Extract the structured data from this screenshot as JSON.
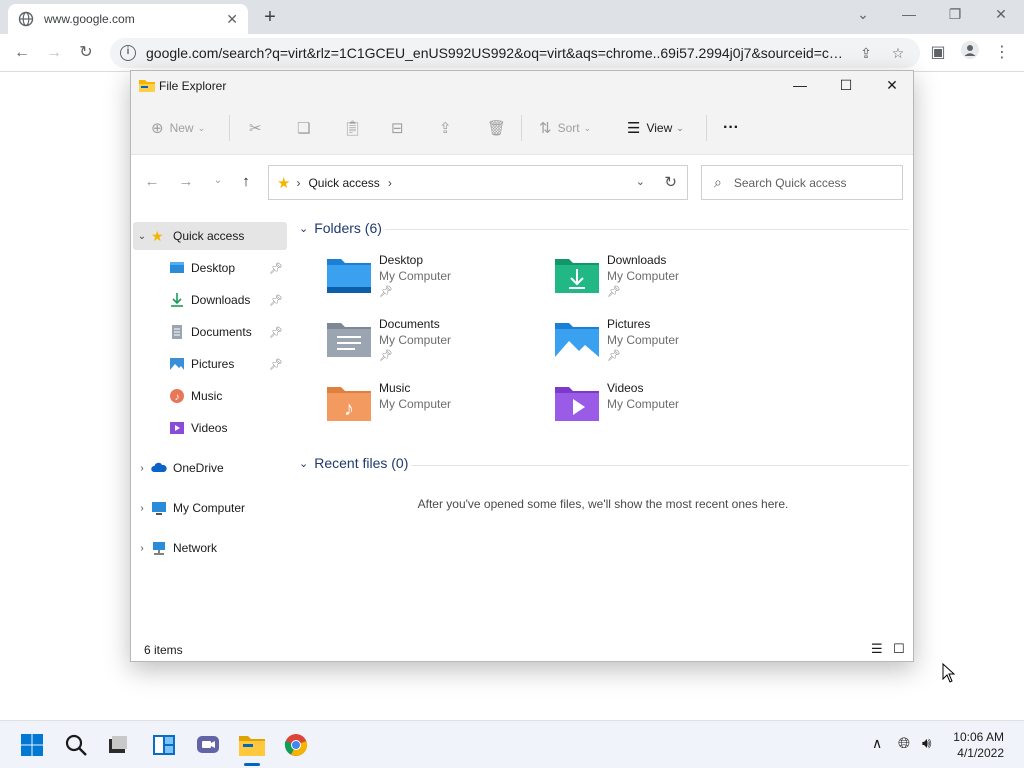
{
  "browser": {
    "tab_title": "www.google.com",
    "tab_close": "✕",
    "new_tab": "+",
    "url": "google.com/search?q=virt&rlz=1C1GCEU_enUS992US992&oq=virt&aqs=chrome..69i57.2994j0j7&sourceid=chr..."
  },
  "explorer": {
    "title": "File Explorer",
    "commands": {
      "new": "New",
      "sort": "Sort",
      "view": "View",
      "more": "···"
    },
    "address": {
      "location": "Quick access"
    },
    "search_placeholder": "Search Quick access",
    "nav": {
      "quick_access": "Quick access",
      "items": [
        "Desktop",
        "Downloads",
        "Documents",
        "Pictures",
        "Music",
        "Videos"
      ],
      "onedrive": "OneDrive",
      "my_computer": "My Computer",
      "network": "Network"
    },
    "folders_header": "Folders (6)",
    "folders": [
      {
        "name": "Desktop",
        "location": "My Computer",
        "pinned": true
      },
      {
        "name": "Downloads",
        "location": "My Computer",
        "pinned": true
      },
      {
        "name": "Documents",
        "location": "My Computer",
        "pinned": true
      },
      {
        "name": "Pictures",
        "location": "My Computer",
        "pinned": true
      },
      {
        "name": "Music",
        "location": "My Computer",
        "pinned": false
      },
      {
        "name": "Videos",
        "location": "My Computer",
        "pinned": false
      }
    ],
    "recent_header": "Recent files (0)",
    "recent_empty": "After you've opened some files, we'll show the most recent ones here.",
    "status_count": "6 items"
  },
  "taskbar": {
    "time": "10:06 AM",
    "date": "4/1/2022"
  },
  "colors": {
    "accent": "#0067c0",
    "group_header": "#1e3a6e",
    "folder_yellow": "#f4b400"
  }
}
